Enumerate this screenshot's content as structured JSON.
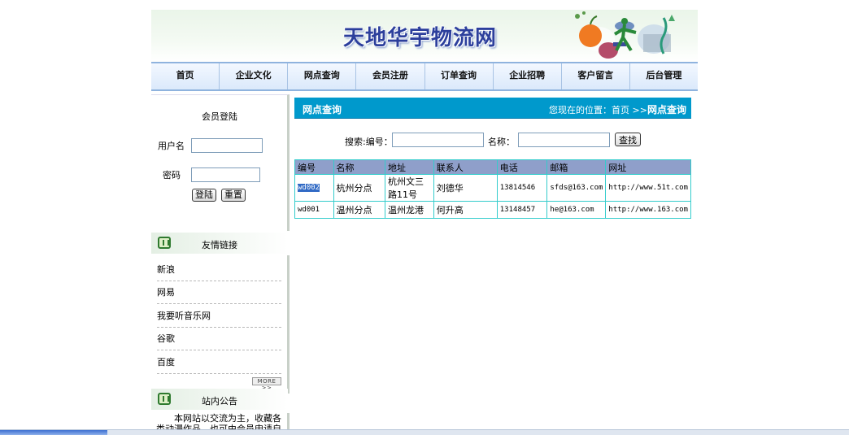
{
  "site": {
    "title": "天地华宇物流网"
  },
  "nav": {
    "items": [
      {
        "label": "首页"
      },
      {
        "label": "企业文化"
      },
      {
        "label": "网点查询"
      },
      {
        "label": "会员注册"
      },
      {
        "label": "订单查询"
      },
      {
        "label": "企业招聘"
      },
      {
        "label": "客户留言"
      },
      {
        "label": "后台管理"
      }
    ]
  },
  "login": {
    "title": "会员登陆",
    "username_label": "用户名",
    "password_label": "密码",
    "username_value": "",
    "password_value": "",
    "login_button": "登陆",
    "reset_button": "重置"
  },
  "links": {
    "title": "友情链接",
    "items": [
      {
        "label": "新浪"
      },
      {
        "label": "网易"
      },
      {
        "label": "我要听音乐网"
      },
      {
        "label": "谷歌"
      },
      {
        "label": "百度"
      }
    ],
    "more_label": "MORE >>"
  },
  "notice": {
    "title": "站内公告",
    "text": "本网站以交流为主，收藏各类动漫作品，也可由会员申请自行上传，有意者敬请联系管理员"
  },
  "main": {
    "header_title": "网点查询",
    "location_prefix": "您现在的位置：首页 >>",
    "location_current": "网点查询",
    "search": {
      "label": "搜索:编号：",
      "number_value": "",
      "name_label": "名称：",
      "name_value": "",
      "button": "查找"
    },
    "table": {
      "columns": [
        "编号",
        "名称",
        "地址",
        "联系人",
        "电话",
        "邮箱",
        "网址"
      ],
      "rows": [
        [
          "wd002",
          "杭州分点",
          "杭州文三路11号",
          "刘德华",
          "13814546",
          "sfds@163.com",
          "http://www.51t.com"
        ],
        [
          "wd001",
          "温州分点",
          "温州龙港",
          "何升高",
          "13148457",
          "he@163.com",
          "http://www.163.com"
        ]
      ]
    }
  },
  "colors": {
    "nav_border": "#8fb3de",
    "main_header": "#0099cc",
    "table_border": "#33cccc",
    "table_header": "#8f9fca",
    "title_text": "#2c3f9c"
  }
}
